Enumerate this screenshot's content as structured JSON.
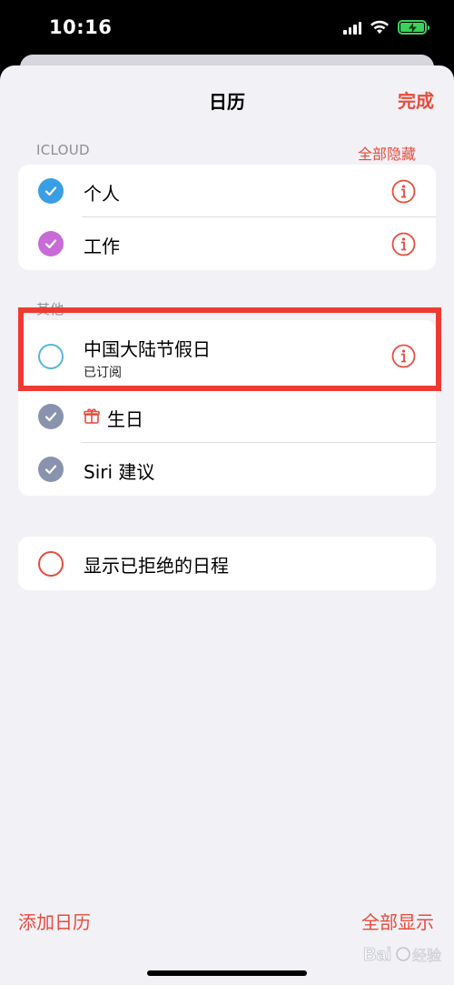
{
  "status_bar": {
    "time": "10:16"
  },
  "nav": {
    "title": "日历",
    "done_label": "完成"
  },
  "icloud_section": {
    "header": "ICLOUD",
    "hide_all_label": "全部隐藏",
    "items": [
      {
        "label": "个人",
        "color": "#3a9ee4",
        "checked": true
      },
      {
        "label": "工作",
        "color": "#c86ad8",
        "checked": true
      }
    ]
  },
  "other_section": {
    "header": "其他",
    "items": [
      {
        "label": "中国大陆节假日",
        "sublabel": "已订阅",
        "color": "#5ab4dc",
        "checked": false
      },
      {
        "label": "生日",
        "color": "#8a93ad",
        "checked": true,
        "icon": "gift-icon"
      },
      {
        "label": "Siri 建议",
        "color": "#8a93ad",
        "checked": true
      }
    ]
  },
  "declined_section": {
    "label": "显示已拒绝的日程",
    "color": "#e74c3c",
    "checked": false
  },
  "bottom_bar": {
    "add_calendar_label": "添加日历",
    "show_all_label": "全部显示"
  },
  "colors": {
    "accent": "#e74c3c",
    "highlight": "#ee3b32"
  },
  "watermark_text": "Baidu 经验"
}
